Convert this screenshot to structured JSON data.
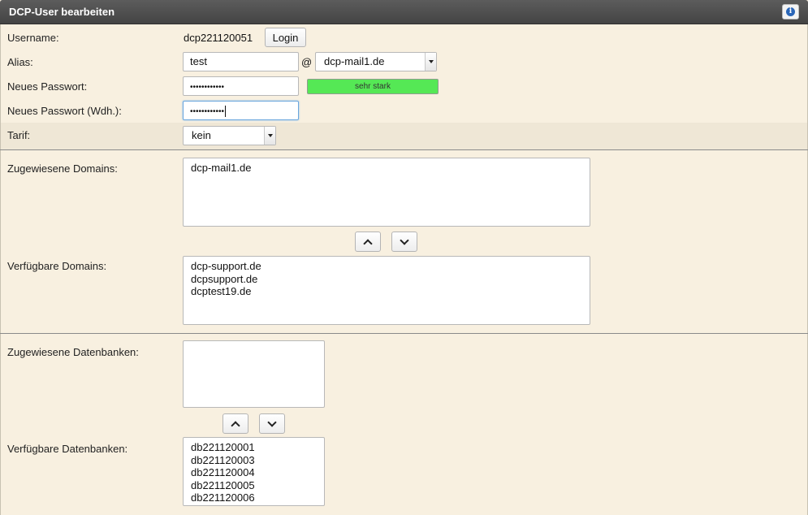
{
  "header": {
    "title": "DCP-User bearbeiten",
    "info_icon": "info-icon"
  },
  "user": {
    "username_label": "Username:",
    "username_value": "dcp221120051",
    "login_button": "Login",
    "alias_label": "Alias:",
    "alias_value": "test",
    "at_sign": "@",
    "alias_domain": "dcp-mail1.de",
    "password_label": "Neues Passwort:",
    "password_mask": "••••••••••••",
    "strength_text": "sehr stark",
    "password_repeat_label": "Neues Passwort (Wdh.):",
    "password_repeat_mask": "••••••••••••",
    "tarif_label": "Tarif:",
    "tarif_value": "kein"
  },
  "domains": {
    "assigned_label": "Zugewiesene Domains:",
    "assigned": [
      "dcp-mail1.de"
    ],
    "available_label": "Verfügbare Domains:",
    "available": [
      "dcp-support.de",
      "dcpsupport.de",
      "dcptest19.de"
    ]
  },
  "databases": {
    "assigned_label": "Zugewiesene Datenbanken:",
    "assigned": [],
    "available_label": "Verfügbare Datenbanken:",
    "available": [
      "db221120001",
      "db221120003",
      "db221120004",
      "db221120005",
      "db221120006"
    ]
  },
  "colors": {
    "header_bg": "#4a4a4a",
    "panel_bg": "#f8f0e0",
    "strength_green": "#55e855",
    "focus_border": "#6aa6dd"
  }
}
